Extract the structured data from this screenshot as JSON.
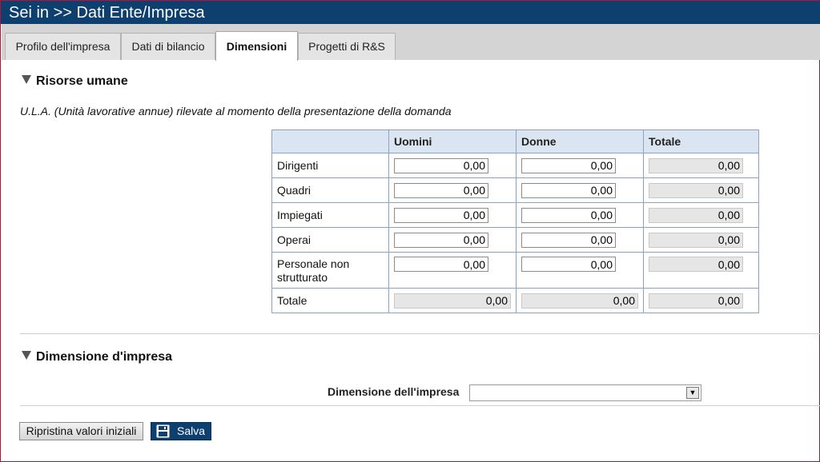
{
  "header": {
    "title": "Sei in >> Dati Ente/Impresa"
  },
  "tabs": [
    {
      "label": "Profilo dell'impresa"
    },
    {
      "label": "Dati di bilancio"
    },
    {
      "label": "Dimensioni"
    },
    {
      "label": "Progetti di R&S"
    }
  ],
  "active_tab": "Dimensioni",
  "risorse": {
    "title": "Risorse umane",
    "subtitle": "U.L.A. (Unità lavorative annue) rilevate al momento della presentazione della domanda",
    "columns": [
      "",
      "Uomini",
      "Donne",
      "Totale"
    ],
    "rows": [
      {
        "label": "Dirigenti",
        "uomini": "0,00",
        "donne": "0,00",
        "totale": "0,00"
      },
      {
        "label": "Quadri",
        "uomini": "0,00",
        "donne": "0,00",
        "totale": "0,00"
      },
      {
        "label": "Impiegati",
        "uomini": "0,00",
        "donne": "0,00",
        "totale": "0,00"
      },
      {
        "label": "Operai",
        "uomini": "0,00",
        "donne": "0,00",
        "totale": "0,00"
      },
      {
        "label": "Personale non strutturato",
        "uomini": "0,00",
        "donne": "0,00",
        "totale": "0,00"
      }
    ],
    "totals": {
      "label": "Totale",
      "uomini": "0,00",
      "donne": "0,00",
      "totale": "0,00"
    }
  },
  "dimensione": {
    "title": "Dimensione d'impresa",
    "field_label": "Dimensione dell'impresa",
    "selected_value": ""
  },
  "buttons": {
    "reset": "Ripristina valori iniziali",
    "save": "Salva"
  },
  "colors": {
    "header_bg": "#0d3f6f",
    "table_header_bg": "#dbe5f1",
    "frame_border": "#b5123a"
  }
}
